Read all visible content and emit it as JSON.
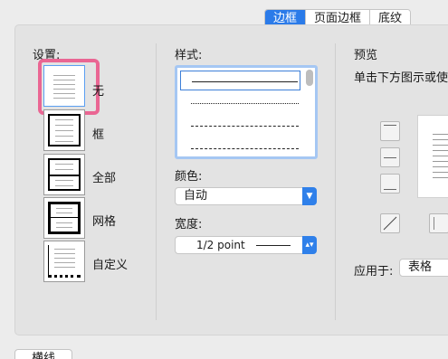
{
  "tabs": [
    {
      "label": "边框",
      "active": true
    },
    {
      "label": "页面边框",
      "active": false
    },
    {
      "label": "底纹",
      "active": false
    }
  ],
  "settings": {
    "heading": "设置:",
    "presets": [
      {
        "label": "无",
        "icon": "border-none-icon",
        "selected": true
      },
      {
        "label": "框",
        "icon": "border-box-icon",
        "selected": false
      },
      {
        "label": "全部",
        "icon": "border-all-icon",
        "selected": false
      },
      {
        "label": "网格",
        "icon": "border-grid-icon",
        "selected": false
      },
      {
        "label": "自定义",
        "icon": "border-custom-icon",
        "selected": false
      }
    ]
  },
  "style": {
    "heading": "样式:",
    "options": [
      "solid",
      "dotted",
      "dashed-fine",
      "dashed"
    ],
    "selected_index": 0
  },
  "color": {
    "heading": "颜色:",
    "value": "自动"
  },
  "width": {
    "heading": "宽度:",
    "value": "1/2 point"
  },
  "preview": {
    "heading": "预览",
    "hint": "单击下方图示或使",
    "apply_label": "应用于:",
    "apply_value": "表格"
  },
  "bottom_button": {
    "label": "横线"
  },
  "colors": {
    "accent": "#2b7be9",
    "highlight": "#ea6693"
  }
}
